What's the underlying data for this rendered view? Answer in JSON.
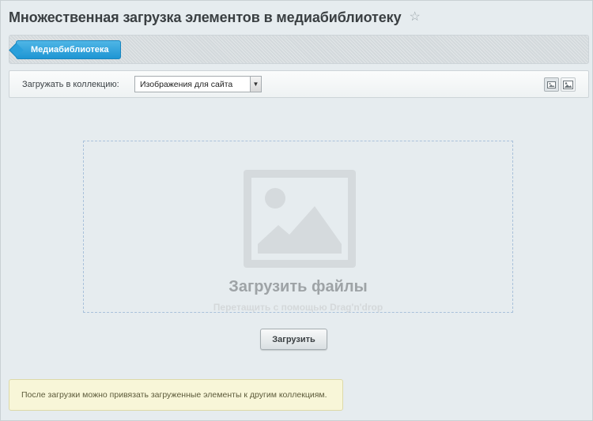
{
  "header": {
    "title": "Множественная загрузка элементов в медиабиблиотеку",
    "favorite_icon": "star-icon"
  },
  "breadcrumb": {
    "items": [
      {
        "label": "Медиабиблиотека"
      }
    ]
  },
  "toolbar": {
    "collection_label": "Загружать в коллекцию:",
    "collection_select": {
      "value": "Изображения для сайта"
    },
    "view_buttons": [
      "small-thumbnails-icon",
      "large-thumbnails-icon"
    ]
  },
  "dropzone": {
    "icon": "image-placeholder-icon",
    "title": "Загрузить файлы",
    "subtitle": "Перетащить с помощью Drag'n'drop"
  },
  "actions": {
    "upload_label": "Загрузить"
  },
  "notice": {
    "text": "После загрузки можно привязать загруженные элементы к другим коллекциям."
  },
  "colors": {
    "background": "#e6ecef",
    "accent": "#1e95d3",
    "notice_bg": "#f8f6d8"
  }
}
